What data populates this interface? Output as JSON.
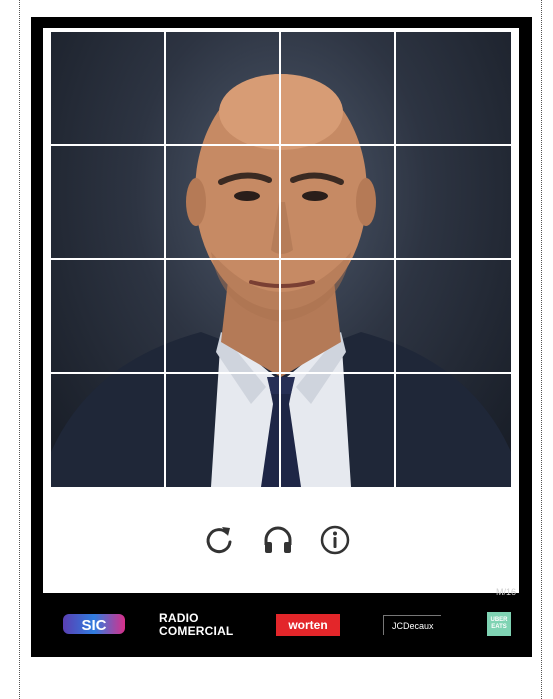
{
  "captcha": {
    "grid": {
      "rows": 4,
      "cols": 4
    },
    "controls": [
      {
        "name": "reload",
        "icon": "reload-icon"
      },
      {
        "name": "audio",
        "icon": "headphones-icon"
      },
      {
        "name": "info",
        "icon": "info-icon"
      }
    ],
    "counter_label": "M/16"
  },
  "sponsors": {
    "sic": "SIC",
    "radio_line1": "RADIO",
    "radio_line2": "COMERCIAL",
    "worten": "worten",
    "jcdecaux": "JCDecaux",
    "ub_line1": "UBER",
    "ub_line2": "EATS"
  },
  "colors": {
    "frame": "#000000",
    "grid_line": "#ffffff",
    "icon": "#333333",
    "worten_red": "#e3262a"
  }
}
